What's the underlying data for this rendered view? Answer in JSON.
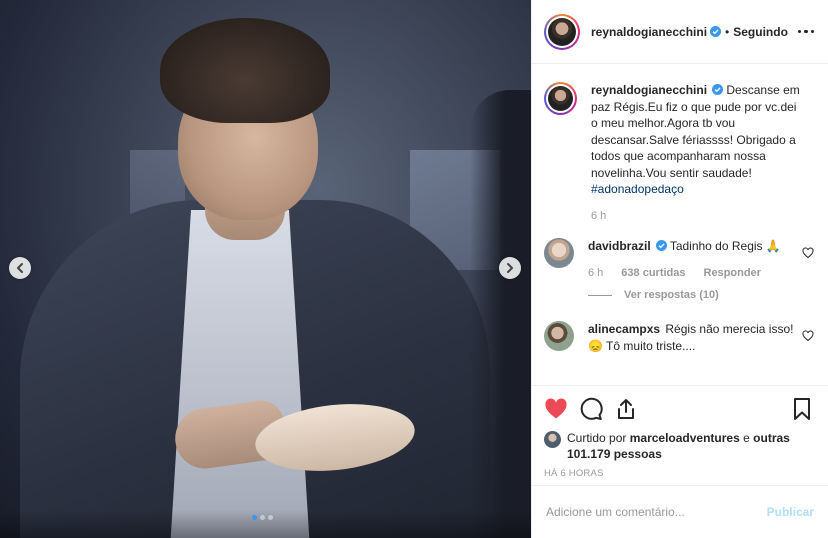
{
  "post": {
    "username": "reynaldogianecchini",
    "follow_status": "Seguindo",
    "caption_text": "Descanse em paz Régis.Eu fiz o que pude por vc.dei o meu melhor.Agora tb vou descansar.Salve fériassss! Obrigado a todos que acompanharam nossa novelinha.Vou sentir saudade!",
    "hashtag": "#adonadopedaço",
    "caption_time": "6 h"
  },
  "comments": [
    {
      "username": "davidbrazil",
      "text": "Tadinho do Regis 🙏",
      "time": "6 h",
      "likes": "638 curtidas",
      "reply_label": "Responder",
      "view_replies": "Ver respostas (10)"
    },
    {
      "username": "alinecampxs",
      "text": "Régis não merecia isso!😞 Tô muito triste...."
    }
  ],
  "likes": {
    "prefix": "Curtido por",
    "user": "marceloadventures",
    "mid": "e",
    "others": "outras 101.179 pessoas"
  },
  "timestamp": "HÁ 6 HORAS",
  "add_comment": {
    "placeholder": "Adicione um comentário...",
    "publish_label": "Publicar"
  },
  "carousel": {
    "count": 3,
    "active": 1
  },
  "colors": {
    "accent": "#3897f0",
    "like_red": "#ed4956",
    "verified": "#3897f0"
  },
  "icons": [
    "chevron-left-icon",
    "chevron-right-icon",
    "verified-icon",
    "more-icon",
    "heart-icon",
    "comment-icon",
    "share-icon",
    "bookmark-icon"
  ]
}
